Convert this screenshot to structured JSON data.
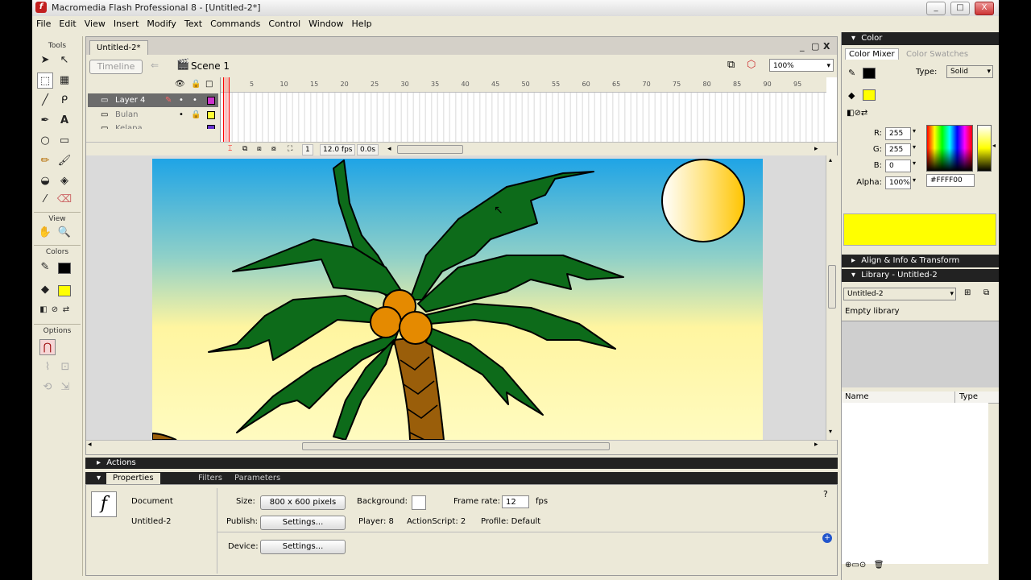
{
  "window": {
    "title": "Macromedia Flash Professional 8 - [Untitled-2*]",
    "controls": [
      "_",
      "□",
      "X"
    ]
  },
  "menu": [
    "File",
    "Edit",
    "View",
    "Insert",
    "Modify",
    "Text",
    "Commands",
    "Control",
    "Window",
    "Help"
  ],
  "tools": {
    "title": "Tools",
    "view_label": "View",
    "colors_label": "Colors",
    "options_label": "Options"
  },
  "document": {
    "tab": "Untitled-2*",
    "timeline_button": "Timeline",
    "scene": "Scene 1",
    "zoom": "100%",
    "doc_controls": [
      "_",
      "▢",
      "X"
    ]
  },
  "timeline": {
    "ruler": [
      "5",
      "10",
      "15",
      "20",
      "25",
      "30",
      "35",
      "40",
      "45",
      "50",
      "55",
      "60",
      "65",
      "70",
      "75",
      "80",
      "85",
      "90",
      "95"
    ],
    "layers": [
      {
        "name": "Layer 4",
        "selected": true,
        "color": "#cc33cc"
      },
      {
        "name": "Bulan",
        "selected": false,
        "color": "#ffff33"
      },
      {
        "name": "Kelapa",
        "selected": false,
        "color": "#6633cc"
      }
    ],
    "current_frame": "1",
    "frame_rate": "12.0 fps",
    "elapsed": "0.0s"
  },
  "panels": {
    "actions": "Actions",
    "properties_tab": "Properties",
    "filters_tab": "Filters",
    "parameters_tab": "Parameters"
  },
  "properties": {
    "doc_type": "Document",
    "doc_name": "Untitled-2",
    "size_label": "Size:",
    "size_value": "800 x 600 pixels",
    "background_label": "Background:",
    "framerate_label": "Frame rate:",
    "framerate_value": "12",
    "fps_label": "fps",
    "publish_label": "Publish:",
    "settings_button": "Settings...",
    "player": "Player: 8",
    "actionscript": "ActionScript: 2",
    "profile": "Profile: Default",
    "device_label": "Device:",
    "device_settings": "Settings..."
  },
  "color_panel": {
    "title": "Color",
    "tab_mixer": "Color Mixer",
    "tab_swatches": "Color Swatches",
    "type_label": "Type:",
    "type_value": "Solid",
    "r_label": "R:",
    "r_value": "255",
    "g_label": "G:",
    "g_value": "255",
    "b_label": "B:",
    "b_value": "0",
    "alpha_label": "Alpha:",
    "alpha_value": "100%",
    "hex_value": "#FFFF00",
    "fill_color": "#ffff00"
  },
  "align_panel": {
    "title": "Align & Info & Transform"
  },
  "library_panel": {
    "title": "Library - Untitled-2",
    "doc_select": "Untitled-2",
    "empty_text": "Empty library",
    "col_name": "Name",
    "col_type": "Type"
  }
}
